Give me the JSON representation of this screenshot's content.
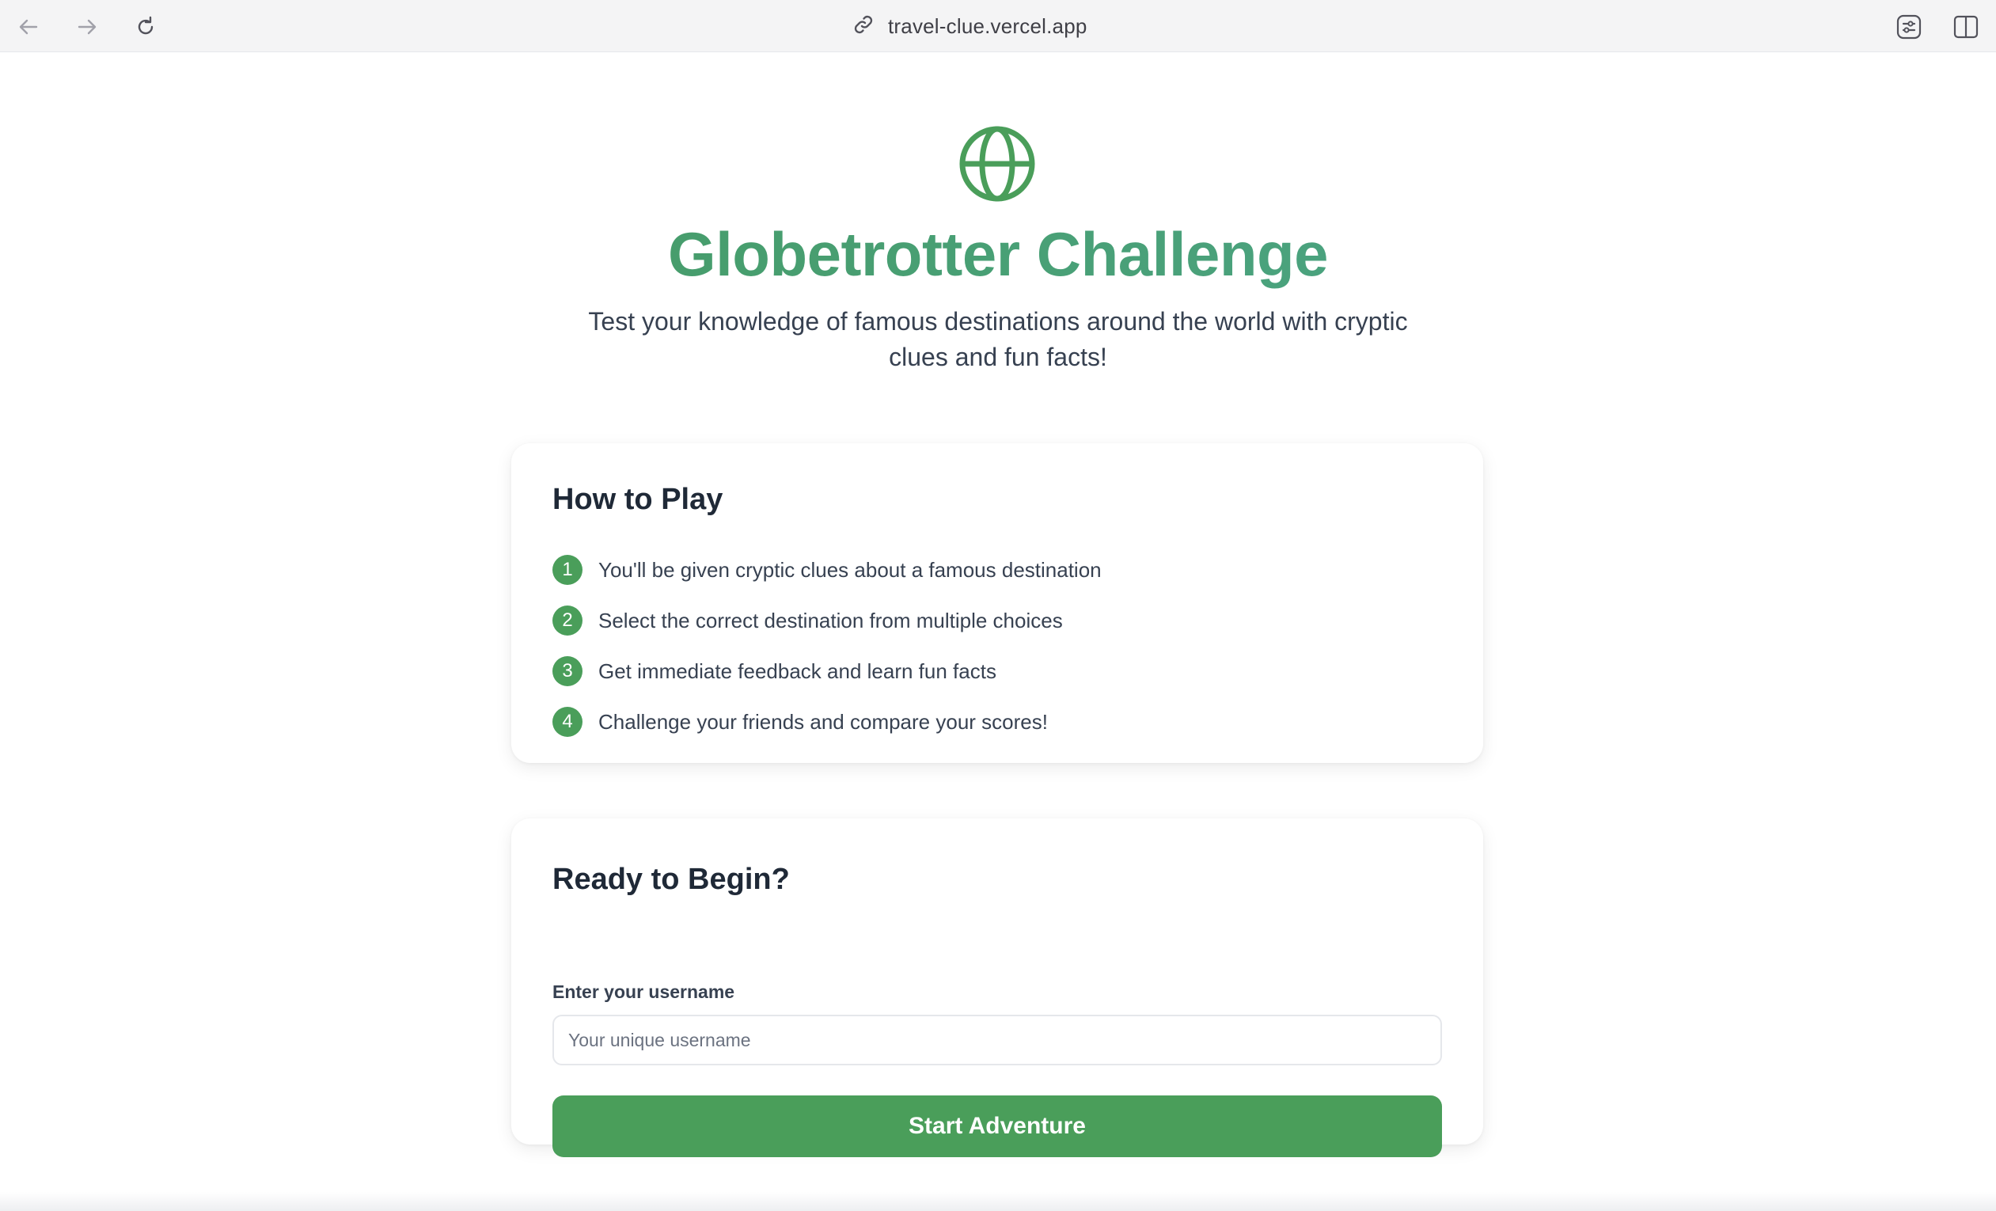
{
  "browser": {
    "url": "travel-clue.vercel.app",
    "icons": {
      "back": "arrow-left-icon",
      "forward": "arrow-right-icon",
      "reload": "reload-icon",
      "link": "link-icon",
      "extensions": "sliders-icon",
      "sidebar": "sidebar-icon"
    }
  },
  "hero": {
    "icon": "globe-icon",
    "title": "Globetrotter Challenge",
    "subtitle": "Test your knowledge of famous destinations around the world with cryptic clues and fun facts!"
  },
  "how_to_play": {
    "title": "How to Play",
    "steps": [
      {
        "number": "1",
        "text": "You'll be given cryptic clues about a famous destination"
      },
      {
        "number": "2",
        "text": "Select the correct destination from multiple choices"
      },
      {
        "number": "3",
        "text": "Get immediate feedback and learn fun facts"
      },
      {
        "number": "4",
        "text": "Challenge your friends and compare your scores!"
      }
    ]
  },
  "ready": {
    "title": "Ready to Begin?",
    "username_label": "Enter your username",
    "username_value": "",
    "username_placeholder": "Your unique username",
    "start_label": "Start Adventure"
  },
  "colors": {
    "accent": "#4a9e5a",
    "title_gradient_start": "#43985b",
    "title_gradient_end": "#4ea78f",
    "text": "#374151",
    "heading": "#1f2937"
  }
}
